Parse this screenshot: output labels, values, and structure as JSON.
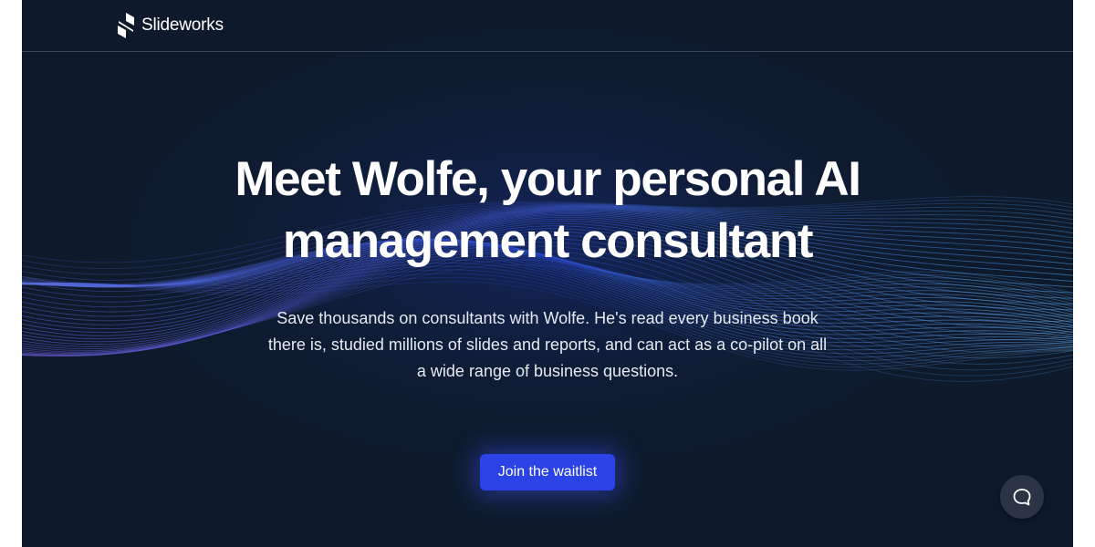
{
  "nav": {
    "brand_name": "Slideworks"
  },
  "hero": {
    "title_line1": "Meet Wolfe, your personal AI",
    "title_line2": "management consultant",
    "subtitle_line1": "Save thousands on consultants with Wolfe. He's read every business book",
    "subtitle_line2": "there is, studied millions of slides and reports, and can act as a co-pilot on all",
    "subtitle_line3": "a wide range of business questions.",
    "cta_label": "Join the waitlist"
  },
  "icons": {
    "brand": "slideworks-logo-icon",
    "chat": "chat-bubble-icon"
  },
  "colors": {
    "background": "#0e1a2c",
    "accent": "#2a42e6",
    "wave_primary": "#4f7fe0",
    "wave_secondary": "#6a5bd6"
  }
}
